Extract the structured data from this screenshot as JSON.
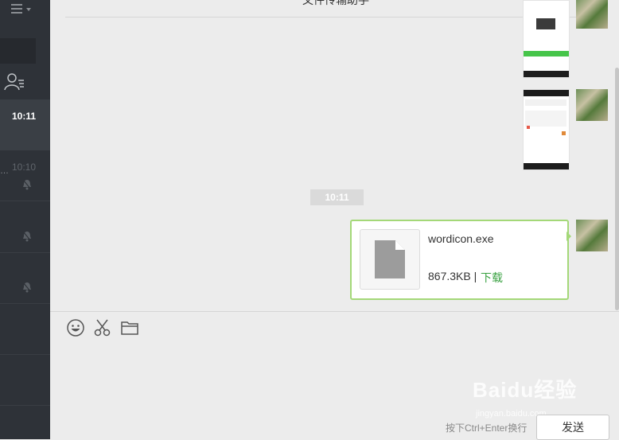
{
  "window": {
    "title": "文件传输助手"
  },
  "sidebar": {
    "menu_icon": "hamburger-menu-icon",
    "contacts_icon": "contacts-icon",
    "chats": [
      {
        "time": "10:11",
        "active": true
      },
      {
        "time": "10:10",
        "ellipsis": "…",
        "muted": true
      },
      {
        "muted": true
      },
      {
        "muted": true
      }
    ]
  },
  "messages": {
    "time_divider": "10:11",
    "file": {
      "name": "wordicon.exe",
      "size": "867.3KB",
      "separator": "|",
      "download_label": "下载",
      "icon": "document-file-icon"
    }
  },
  "composer": {
    "tools": [
      "emoji-icon",
      "scissors-icon",
      "folder-icon"
    ],
    "hint": "按下Ctrl+Enter换行",
    "send_label": "发送"
  },
  "colors": {
    "sidebar_bg": "#2e3238",
    "accent_green": "#3aa142",
    "bubble_border": "#a4d878"
  },
  "watermark": {
    "brand": "Baidu经验",
    "url": "jingyan.baidu.com"
  }
}
